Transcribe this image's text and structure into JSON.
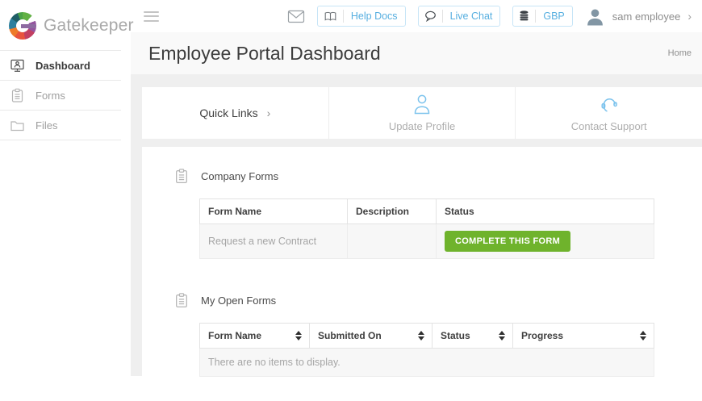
{
  "brand": {
    "name": "Gatekeeper"
  },
  "sidebar": {
    "items": [
      {
        "label": "Dashboard",
        "active": true
      },
      {
        "label": "Forms",
        "active": false
      },
      {
        "label": "Files",
        "active": false
      }
    ]
  },
  "header": {
    "help_docs": "Help Docs",
    "live_chat": "Live Chat",
    "currency": "GBP",
    "user_name": "sam employee"
  },
  "page": {
    "title": "Employee Portal Dashboard",
    "breadcrumb": "Home"
  },
  "quick_links": {
    "label": "Quick Links",
    "items": [
      {
        "label": "Update Profile",
        "icon": "person-icon"
      },
      {
        "label": "Contact Support",
        "icon": "headset-icon"
      }
    ]
  },
  "company_forms": {
    "title": "Company Forms",
    "columns": [
      "Form Name",
      "Description",
      "Status"
    ],
    "rows": [
      {
        "form_name": "Request a new Contract",
        "description": "",
        "action": "COMPLETE THIS FORM"
      }
    ]
  },
  "my_open_forms": {
    "title": "My Open Forms",
    "columns": [
      "Form Name",
      "Submitted On",
      "Status",
      "Progress"
    ],
    "empty_message": "There are no items to display."
  },
  "colors": {
    "accent_blue": "#57afe0",
    "button_green": "#6fb32c",
    "avatar_gray_blue": "#8296a4"
  }
}
